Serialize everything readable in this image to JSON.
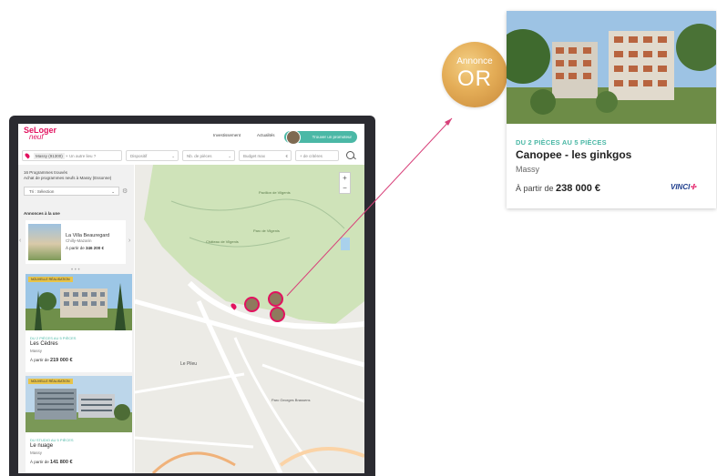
{
  "app": {
    "logo_main": "SeLoger",
    "logo_sub": "neuf",
    "nav": {
      "investment": "Investissement",
      "news": "Actualités",
      "find_promoter": "Trouver un promoteur"
    }
  },
  "search": {
    "location_chip": "Massy (91300)",
    "other_place_placeholder": "Un autre lieu ?",
    "dispositif": "Dispositif",
    "rooms": "Nb. de pièces",
    "budget": "Budget max",
    "budget_unit": "€",
    "more_criteria": "+ de critères"
  },
  "results": {
    "count_line": "16 Programmes trouvés",
    "subtitle": "Achat de programmes neufs à Massy (Essonne)",
    "sort_label": "Tri : Sélection",
    "section_title": "Annonces à la une",
    "featured": {
      "name": "La Villa Beauregard",
      "city": "Chilly-Mazarin",
      "price_prefix": "À partir de",
      "price": "346 200 €"
    },
    "cards": [
      {
        "badge": "NOUVELLE RÉALISATION",
        "eyebrow": "DU 2 PIÈCES AU 5 PIÈCES",
        "name": "Les Cèdres",
        "city": "Massy",
        "price_prefix": "À partir de",
        "price": "219 000 €"
      },
      {
        "badge": "NOUVELLE RÉALISATION",
        "eyebrow": "DU STUDIO AU 5 PIÈCES",
        "name": "Le nuage",
        "city": "Massy",
        "price_prefix": "À partir de",
        "price": "141 800 €"
      }
    ]
  },
  "map": {
    "zoom_in": "+",
    "zoom_out": "−",
    "labels": {
      "pavillon": "Pavillon de Vilgenis",
      "chateau": "Château de Vilgenis",
      "park": "Parc de Vilgenis",
      "le_pileu": "Le Pileu",
      "parc_georges": "Parc Georges Brassens"
    }
  },
  "highlight_badge": {
    "line1": "Annonce",
    "line2": "OR"
  },
  "detail_card": {
    "eyebrow": "DU 2 PIÈCES AU 5 PIÈCES",
    "title": "Canopee - les ginkgos",
    "city": "Massy",
    "price_prefix": "À partir de",
    "price": "238 000 €",
    "brand": "VINCI"
  },
  "colors": {
    "brand_pink": "#e2125f",
    "accent_teal": "#4bb8a6",
    "gold": "#e4ad57",
    "park_green": "#cfe3b9"
  }
}
